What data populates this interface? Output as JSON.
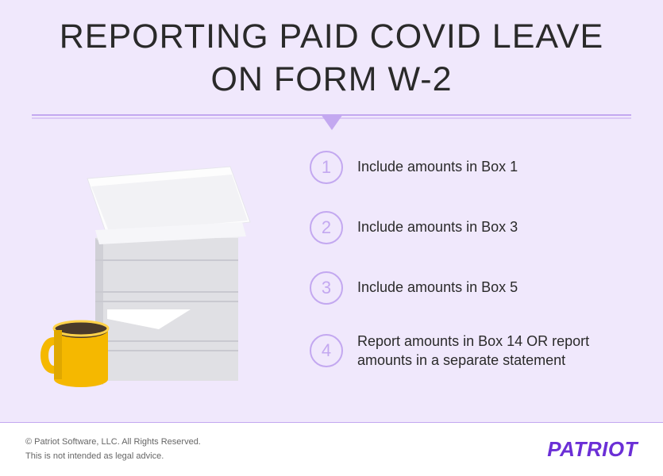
{
  "title": "REPORTING PAID COVID LEAVE ON FORM W-2",
  "steps": [
    {
      "num": "1",
      "text": "Include amounts in Box 1"
    },
    {
      "num": "2",
      "text": "Include amounts in Box 3"
    },
    {
      "num": "3",
      "text": "Include amounts in Box 5"
    },
    {
      "num": "4",
      "text": "Report amounts in Box 14 OR report amounts in a separate statement"
    }
  ],
  "footer": {
    "copyright": "© Patriot Software, LLC. All Rights Reserved.",
    "disclaimer": "This is not intended as legal advice.",
    "logo": "PATRIOT"
  }
}
